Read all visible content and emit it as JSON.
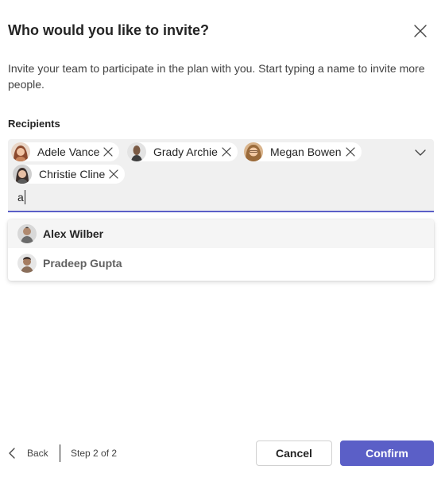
{
  "dialog": {
    "title": "Who would you like to invite?",
    "description": "Invite your team to participate in the plan with you. Start typing a name to invite more people.",
    "close_icon": "close-icon"
  },
  "recipients": {
    "label": "Recipients",
    "chips": [
      {
        "name": "Adele Vance",
        "avatar_color": "#c8845c"
      },
      {
        "name": "Grady Archie",
        "avatar_color": "#7a5a44"
      },
      {
        "name": "Megan Bowen",
        "avatar_color": "#b07a52"
      },
      {
        "name": "Christie Cline",
        "avatar_color": "#5a5a5a"
      }
    ],
    "typed_text": "a",
    "dropdown_icon": "chevron-down-icon"
  },
  "suggestions": [
    {
      "name": "Alex Wilber",
      "avatar_color": "#6b6b6b",
      "highlighted": true
    },
    {
      "name": "Pradeep Gupta",
      "avatar_color": "#8a6e5a",
      "highlighted": false
    }
  ],
  "footer": {
    "back_label": "Back",
    "step_text": "Step 2 of 2",
    "cancel_label": "Cancel",
    "confirm_label": "Confirm"
  },
  "colors": {
    "accent": "#5b5fc7",
    "picker_bg": "#f0f0f0",
    "text": "#242424",
    "muted_text": "#424242",
    "suggestion_hover": "#f5f5f5"
  }
}
